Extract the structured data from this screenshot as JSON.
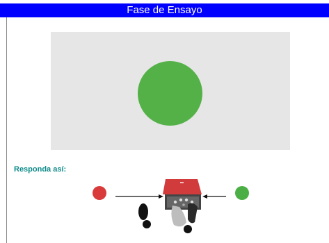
{
  "header": {
    "title": "Fase de Ensayo"
  },
  "stage": {
    "background": "#e6e6e6",
    "stimulus_color": "#54b148",
    "stimulus_shape": "circle"
  },
  "instructions": {
    "label": "Responda así:"
  },
  "response_diagram": {
    "left_target_color": "#d93a3a",
    "right_target_color": "#4caf45",
    "device_color": "#c83a3a",
    "icons": [
      "red-circle-icon",
      "green-circle-icon",
      "arrow-right-icon",
      "arrow-left-icon",
      "response-box-icon",
      "shoe-print-icon"
    ]
  },
  "colors": {
    "title_bar": "#0000ff",
    "title_text": "#ffffff",
    "instruction_text": "#0e8a8a"
  }
}
